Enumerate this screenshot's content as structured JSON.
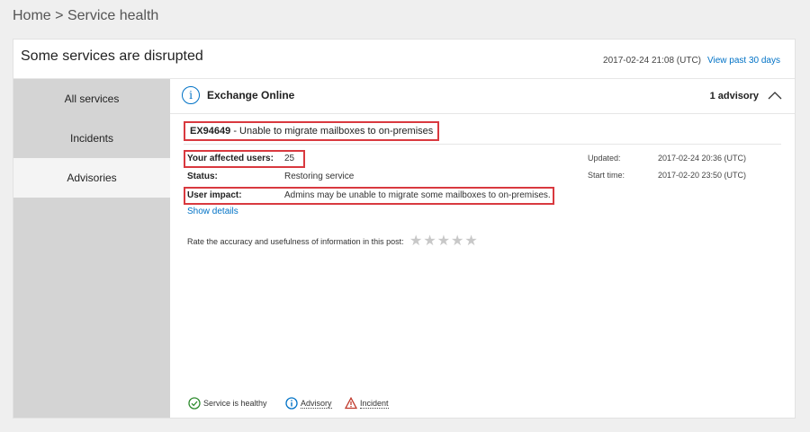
{
  "breadcrumb": {
    "home": "Home",
    "sep": ">",
    "current": "Service health"
  },
  "header": {
    "title": "Some services are disrupted",
    "timestamp": "2017-02-24 21:08 (UTC)",
    "view_past": "View past 30 days"
  },
  "sidebar": {
    "items": [
      {
        "label": "All services",
        "active": false
      },
      {
        "label": "Incidents",
        "active": false
      },
      {
        "label": "Advisories",
        "active": true
      }
    ]
  },
  "service": {
    "name": "Exchange Online",
    "advisory_count": "1 advisory",
    "icon": "info-icon"
  },
  "advisory": {
    "id": "EX94649",
    "separator": " - ",
    "title": "Unable to migrate mailboxes to on-premises",
    "affected_label": "Your affected users:",
    "affected_value": "25",
    "status_label": "Status:",
    "status_value": "Restoring service",
    "impact_label": "User impact:",
    "impact_value": "Admins may be unable to migrate some mailboxes to on-premises.",
    "updated_label": "Updated:",
    "updated_value": "2017-02-24 20:36 (UTC)",
    "start_label": "Start time:",
    "start_value": "2017-02-20 23:50 (UTC)",
    "show_details": "Show details",
    "rate_text": "Rate the accuracy and usefulness of information in this post:",
    "rating": 0,
    "rating_max": 5
  },
  "legend": {
    "healthy": "Service is healthy",
    "advisory": "Advisory",
    "incident": "Incident"
  },
  "colors": {
    "accent": "#0072c6",
    "highlight": "#d9393f",
    "healthy": "#2e8b2e",
    "incident": "#c0392b"
  }
}
